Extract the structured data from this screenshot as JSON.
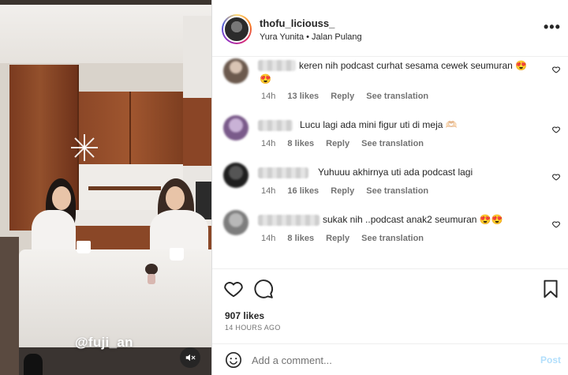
{
  "video": {
    "overlay_handle": "@fuji_an",
    "mute_icon": "speaker-muted-icon"
  },
  "post_header": {
    "username": "thofu_liciouss_",
    "subtitle": "Yura Yunita • Jalan Pulang",
    "more_icon": "more-options-icon",
    "more_label": "•••"
  },
  "comments": [
    {
      "text": "keren nih podcast curhat sesama cewek seumuran 😍",
      "text_line2": "😍",
      "time": "14h",
      "likes": "13 likes",
      "reply": "Reply",
      "translate": "See translation"
    },
    {
      "text": "Lucu lagi ada mini figur uti di meja 🫶🏻",
      "time": "14h",
      "likes": "8 likes",
      "reply": "Reply",
      "translate": "See translation"
    },
    {
      "text": "Yuhuuu akhirnya uti ada podcast lagi",
      "time": "14h",
      "likes": "16 likes",
      "reply": "Reply",
      "translate": "See translation"
    },
    {
      "text": "sukak nih ..podcast anak2 seumuran 😍😍",
      "time": "14h",
      "likes": "8 likes",
      "reply": "Reply",
      "translate": "See translation"
    }
  ],
  "actions": {
    "like_icon": "heart-icon",
    "comment_icon": "comment-icon",
    "save_icon": "bookmark-icon",
    "likes_count": "907 likes",
    "posted_time": "14 HOURS AGO"
  },
  "add_comment": {
    "placeholder": "Add a comment...",
    "post_label": "Post",
    "emoji_icon": "emoji-icon"
  },
  "colors": {
    "text": "#262626",
    "secondary": "#737373",
    "post_disabled": "#b2dffc"
  }
}
